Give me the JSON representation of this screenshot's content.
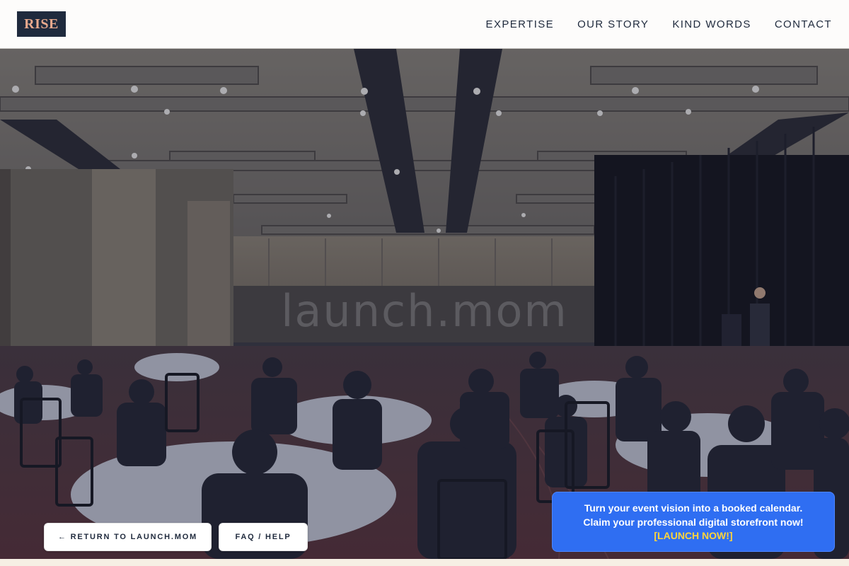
{
  "header": {
    "logo_text": "RISE",
    "nav": [
      {
        "label": "EXPERTISE"
      },
      {
        "label": "OUR STORY"
      },
      {
        "label": "KIND WORDS"
      },
      {
        "label": "CONTACT"
      }
    ]
  },
  "hero": {
    "image_alt": "Conference ballroom with round tables, seated audience and speaker at podium on stage",
    "watermark": "launch.mom"
  },
  "buttons": {
    "return_label": "← RETURN TO LAUNCH.MOM",
    "faq_label": "FAQ / HELP"
  },
  "promo": {
    "line1": "Turn your event vision into a booked calendar.",
    "line2": "Claim your professional digital storefront now!",
    "cta": "[LAUNCH NOW!]"
  },
  "colors": {
    "navy": "#1f2a3d",
    "logo_accent": "#e8a98d",
    "promo_blue": "#2f6ef2",
    "cta_yellow": "#ffd43b"
  }
}
